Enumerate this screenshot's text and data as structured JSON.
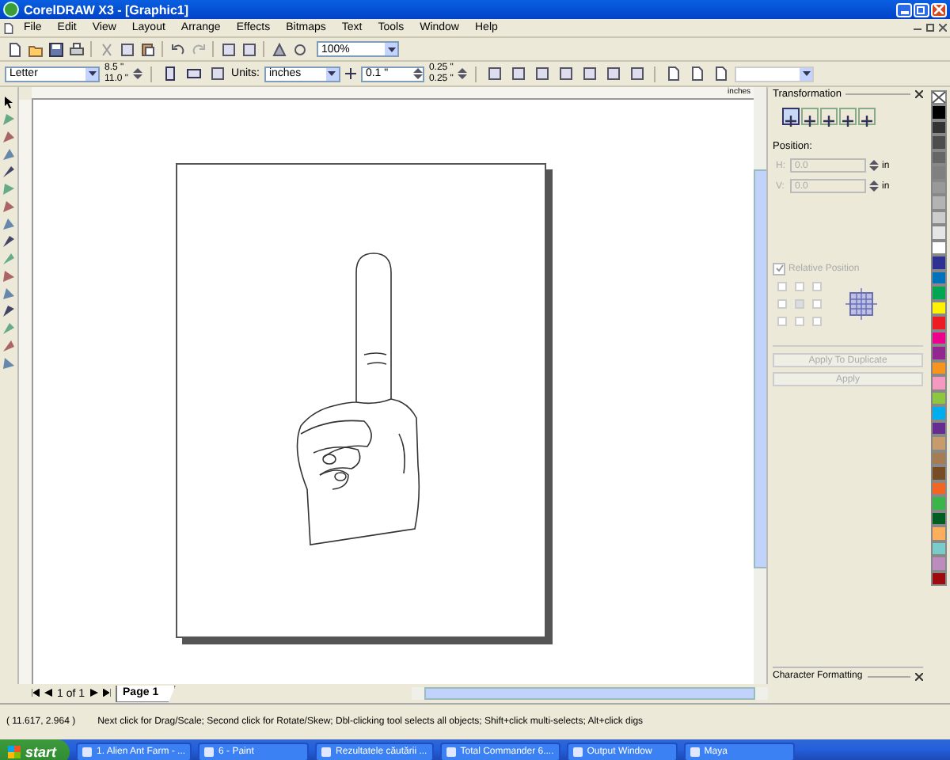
{
  "window": {
    "title": "CorelDRAW X3 - [Graphic1]"
  },
  "menu": [
    "File",
    "Edit",
    "View",
    "Layout",
    "Arrange",
    "Effects",
    "Bitmaps",
    "Text",
    "Tools",
    "Window",
    "Help"
  ],
  "standard_toolbar": {
    "zoom": "100%"
  },
  "property_bar": {
    "paper": "Letter",
    "width": "8.5 \"",
    "height": "11.0 \"",
    "units_label": "Units:",
    "units": "inches",
    "nudge": "0.1 \"",
    "dup_x": "0.25 \"",
    "dup_y": "0.25 \""
  },
  "ruler": {
    "unit": "inches"
  },
  "docker": {
    "title": "Transformation",
    "tabs": [
      {
        "selected": true
      },
      {
        "selected": false
      },
      {
        "selected": false
      },
      {
        "selected": false
      },
      {
        "selected": false
      }
    ],
    "section": "Position:",
    "fields": [
      {
        "label": "H:",
        "value": "0.0",
        "unit": "in"
      },
      {
        "label": "V:",
        "value": "0.0",
        "unit": "in"
      }
    ],
    "relative_position": {
      "label": "Relative Position",
      "checked": true
    },
    "anchors": [
      {
        "selected": false
      },
      {
        "selected": false
      },
      {
        "selected": false
      },
      {
        "selected": false
      },
      {
        "selected": true
      },
      {
        "selected": false
      },
      {
        "selected": false
      },
      {
        "selected": false
      },
      {
        "selected": false
      }
    ],
    "buttons": [
      "Apply To Duplicate",
      "Apply"
    ]
  },
  "character_docker": {
    "title": "Character Formatting"
  },
  "palette": [
    {
      "color": "#000000"
    },
    {
      "color": "#333333"
    },
    {
      "color": "#4d4d4d"
    },
    {
      "color": "#666666"
    },
    {
      "color": "#808080"
    },
    {
      "color": "#999999"
    },
    {
      "color": "#b3b3b3"
    },
    {
      "color": "#cccccc"
    },
    {
      "color": "#e5e5e5"
    },
    {
      "color": "#ffffff"
    },
    {
      "color": "#2e3192"
    },
    {
      "color": "#0072bc"
    },
    {
      "color": "#00a651"
    },
    {
      "color": "#fff200"
    },
    {
      "color": "#ed1c24"
    },
    {
      "color": "#ec008c"
    },
    {
      "color": "#92278f"
    },
    {
      "color": "#f7941d"
    },
    {
      "color": "#f49ac1"
    },
    {
      "color": "#8dc63f"
    },
    {
      "color": "#00aeef"
    },
    {
      "color": "#662d91"
    },
    {
      "color": "#c69c6d"
    },
    {
      "color": "#a67c52"
    },
    {
      "color": "#754c24"
    },
    {
      "color": "#f26522"
    },
    {
      "color": "#39b54a"
    },
    {
      "color": "#005e20"
    },
    {
      "color": "#fbaf5d"
    },
    {
      "color": "#7accc8"
    },
    {
      "color": "#bd8cbf"
    },
    {
      "color": "#9e0b0f"
    }
  ],
  "page_nav": {
    "count": "1 of 1",
    "tabs": [
      {
        "label": "Page 1",
        "selected": true
      }
    ]
  },
  "status_bar": {
    "coords": "( 11.617, 2.964 )",
    "message": "Next click for Drag/Scale; Second click for Rotate/Skew; Dbl-clicking tool selects all objects; Shift+click multi-selects; Alt+click digs"
  },
  "taskbar": {
    "start": "start",
    "items": [
      {
        "label": "1. Alien Ant Farm - ..."
      },
      {
        "label": "6 - Paint"
      },
      {
        "label": "Rezultatele căutării ..."
      },
      {
        "label": "Total Commander 6...."
      },
      {
        "label": "Output Window"
      },
      {
        "label": "Maya"
      }
    ]
  }
}
